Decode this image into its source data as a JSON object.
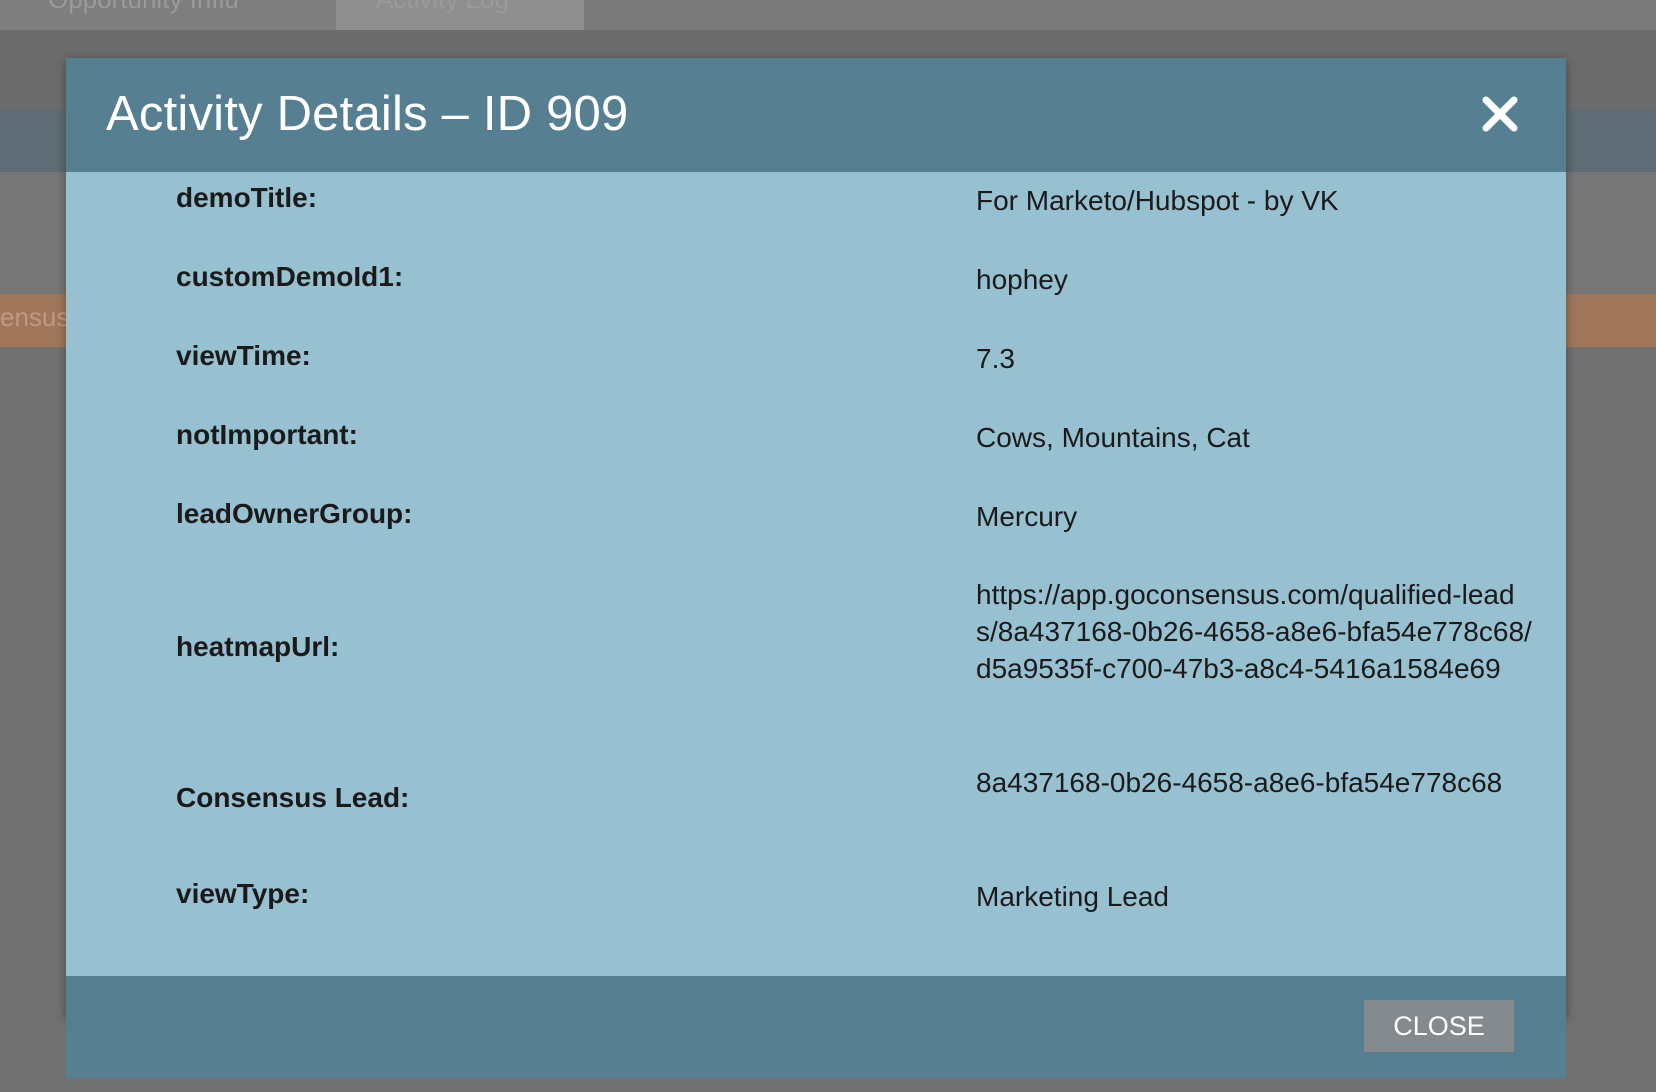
{
  "background": {
    "tab_1": "Opportunity Influ",
    "tab_2": "Activity Log",
    "orange_fragment": "ensus"
  },
  "modal": {
    "title": "Activity Details – ID 909",
    "close_icon": "close-x-icon",
    "rows": [
      {
        "label": "demoTitle:",
        "value": "For Marketo/Hubspot - by VK"
      },
      {
        "label": "customDemoId1:",
        "value": "hophey"
      },
      {
        "label": "viewTime:",
        "value": "7.3"
      },
      {
        "label": "notImportant:",
        "value": "Cows, Mountains, Cat"
      },
      {
        "label": "leadOwnerGroup:",
        "value": "Mercury"
      },
      {
        "label": "heatmapUrl:",
        "value": "https://app.goconsensus.com/qualified-leads/8a437168-0b26-4658-a8e6-bfa54e778c68/d5a9535f-c700-47b3-a8c4-5416a1584e69"
      },
      {
        "label": "Consensus Lead:",
        "value": "8a437168-0b26-4658-a8e6-bfa54e778c68"
      },
      {
        "label": "viewType:",
        "value": "Marketing Lead"
      }
    ],
    "footer": {
      "close_label": "CLOSE"
    }
  },
  "colors": {
    "header": "#577f92",
    "body": "#97c0d1",
    "button": "#848a8e",
    "orange_band": "#a1775b"
  }
}
